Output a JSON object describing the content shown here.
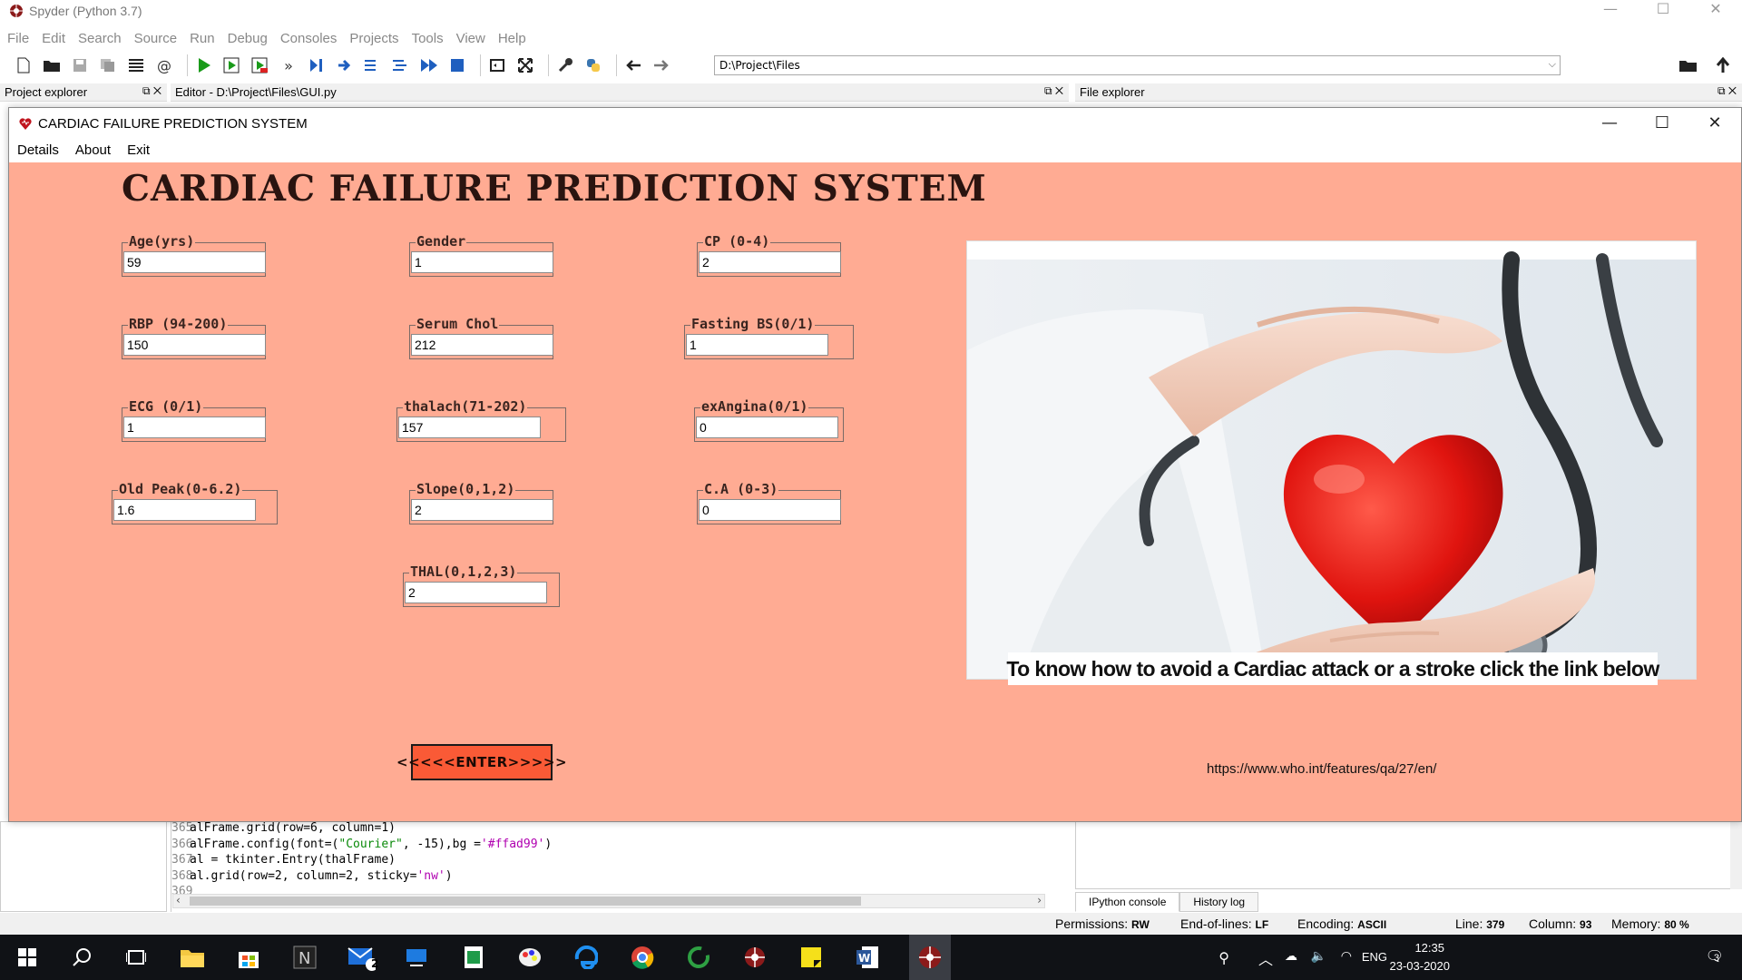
{
  "spyder": {
    "title": "Spyder (Python 3.7)",
    "window_controls": [
      "—",
      "☐",
      "✕"
    ],
    "menu": [
      "File",
      "Edit",
      "Search",
      "Source",
      "Run",
      "Debug",
      "Consoles",
      "Projects",
      "Tools",
      "View",
      "Help"
    ],
    "path": "D:\\Project\\Files",
    "panes": {
      "project_explorer": "Project explorer",
      "editor": "Editor - D:\\Project\\Files\\GUI.py",
      "file_explorer": "File explorer"
    },
    "editor_lines": [
      {
        "num": "365",
        "code": "alFrame.grid(row=6, column=1)"
      },
      {
        "num": "366",
        "code_a": "alFrame.config(font=(",
        "str1": "\"Courier\"",
        "code_b": ", -15),bg =",
        "str2": "'#ffad99'",
        "code_c": ")"
      },
      {
        "num": "367",
        "code": "al = tkinter.Entry(thalFrame)"
      },
      {
        "num": "368",
        "code_a": "al.grid(row=2, column=2, sticky=",
        "str1": "'nw'",
        "code_b": ")"
      },
      {
        "num": "369",
        "code": ""
      }
    ],
    "console_tabs": [
      "IPython console",
      "History log"
    ],
    "status": {
      "permissions_label": "Permissions:",
      "permissions": "RW",
      "eol_label": "End-of-lines:",
      "eol": "LF",
      "encoding_label": "Encoding:",
      "encoding": "ASCII",
      "line_label": "Line:",
      "line": "379",
      "column_label": "Column:",
      "column": "93",
      "memory_label": "Memory:",
      "memory": "80 %"
    }
  },
  "app": {
    "window_title": "CARDIAC FAILURE PREDICTION SYSTEM",
    "menu": [
      "Details",
      "About",
      "Exit"
    ],
    "heading": "CARDIAC FAILURE PREDICTION SYSTEM",
    "fields": {
      "age": {
        "label": "Age(yrs)",
        "value": "59"
      },
      "gender": {
        "label": "Gender",
        "value": "1"
      },
      "cp": {
        "label": "CP (0-4)",
        "value": "2"
      },
      "rbp": {
        "label": "RBP (94-200)",
        "value": "150"
      },
      "serum_chol": {
        "label": "Serum Chol",
        "value": "212"
      },
      "fasting_bs": {
        "label": "Fasting BS(0/1)",
        "value": "1"
      },
      "ecg": {
        "label": "ECG (0/1)",
        "value": "1"
      },
      "thalach": {
        "label": "thalach(71-202)",
        "value": "157"
      },
      "exangina": {
        "label": "exAngina(0/1)",
        "value": "0"
      },
      "old_peak": {
        "label": "Old Peak(0-6.2)",
        "value": "1.6"
      },
      "slope": {
        "label": "Slope(0,1,2)",
        "value": "2"
      },
      "ca": {
        "label": "C.A (0-3)",
        "value": "0"
      },
      "thal": {
        "label": "THAL(0,1,2,3)",
        "value": "2"
      }
    },
    "enter_button": "<<<<<ENTER>>>>>",
    "image_caption": "To know how  to avoid a Cardiac attack or a stroke click the link below",
    "link": "https://www.who.int/features/qa/27/en/",
    "bg_color": "#ffab93",
    "button_color": "#fa5a36"
  },
  "taskbar": {
    "mail_badge": "2",
    "language": "ENG",
    "time": "12:35",
    "date": "23-03-2020",
    "notification_count": "3"
  }
}
